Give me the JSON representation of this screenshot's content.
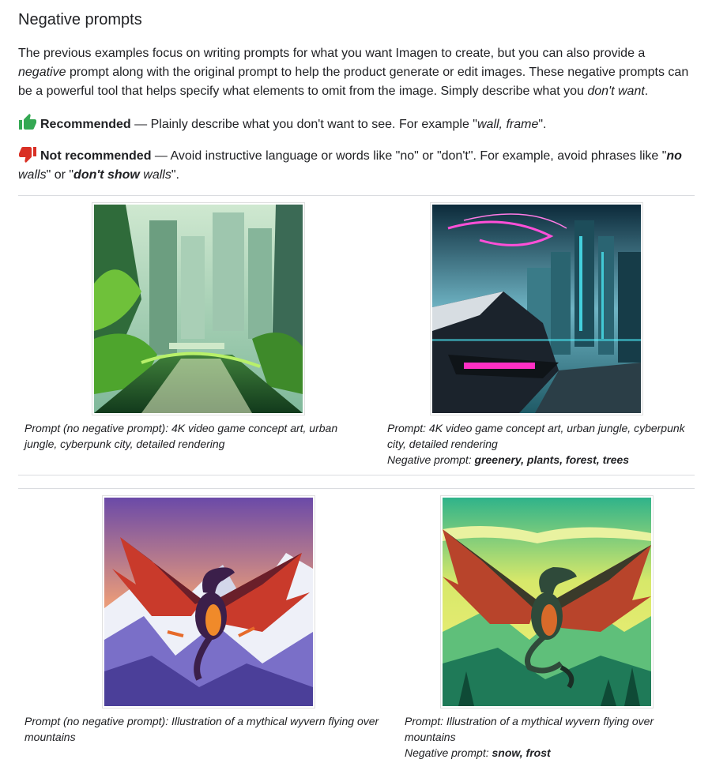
{
  "heading": "Negative prompts",
  "intro": {
    "part1": "The previous examples focus on writing prompts for what you want Imagen to create, but you can also provide a ",
    "negative_word": "negative",
    "part2": " prompt along with the original prompt to help the product generate or edit images. These negative prompts can be a powerful tool that helps specify what elements to omit from the image. Simply describe what you ",
    "dont_want": "don't want",
    "part3": "."
  },
  "recommended": {
    "label": "Recommended",
    "text_before": " — Plainly describe what you don't want to see. For example \"",
    "example": "wall, frame",
    "text_after": "\"."
  },
  "not_recommended": {
    "label": "Not recommended",
    "text_before": " — Avoid instructive language or words like \"no\" or \"don't\". For example, avoid phrases like \"",
    "ex1_bold": "no",
    "ex1_rest": " walls",
    "mid": "\" or \"",
    "ex2_bold": "don't show",
    "ex2_rest": " walls",
    "end": "\"."
  },
  "examples": [
    {
      "image": "urban-jungle-image",
      "prompt_label": "Prompt (no negative prompt): ",
      "prompt": "4K video game concept art, urban jungle, cyberpunk city, detailed rendering"
    },
    {
      "image": "cyberpunk-city-image",
      "prompt_label": "Prompt: ",
      "prompt": "4K video game concept art, urban jungle, cyberpunk city, detailed rendering",
      "negative_label": "Negative prompt: ",
      "negative": "greenery, plants, forest, trees"
    },
    {
      "image": "wyvern-snowy-mountains-image",
      "prompt_label": "Prompt (no negative prompt): ",
      "prompt": "Illustration of a mythical wyvern flying over mountains"
    },
    {
      "image": "wyvern-green-mountains-image",
      "prompt_label": "Prompt: ",
      "prompt": "Illustration of a mythical wyvern flying over mountains",
      "negative_label": "Negative prompt: ",
      "negative": "snow, frost"
    }
  ],
  "colors": {
    "thumb_up": "#34a853",
    "thumb_down": "#d93025",
    "divider": "#dadce0"
  }
}
